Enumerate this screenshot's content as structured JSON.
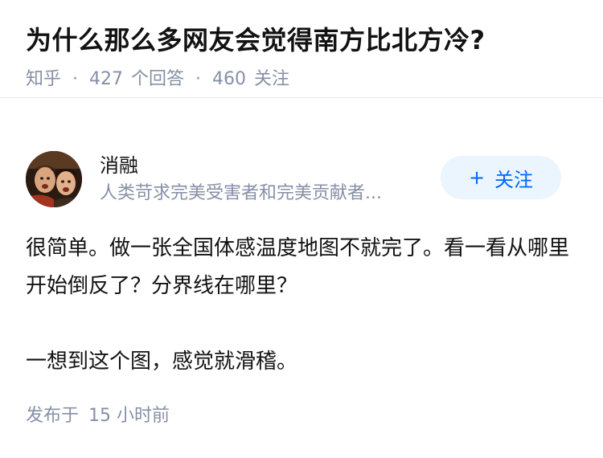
{
  "question": {
    "title": "为什么那么多网友会觉得南方比北方冷?",
    "source": "知乎",
    "answers_count": "427",
    "answers_label": "个回答",
    "followers_count": "460",
    "followers_label": "关注"
  },
  "author": {
    "name": "消融",
    "bio": "人类苛求完美受害者和完美贡献者...",
    "follow_label": "关注",
    "follow_icon": "plus-icon"
  },
  "answer": {
    "paragraphs": [
      "很简单。做一张全国体感温度地图不就完了。看一看从哪里开始倒反了？分界线在哪里？",
      "一想到这个图，感觉就滑稽。"
    ],
    "published_label": "发布于",
    "published_time": "15 小时前"
  },
  "colors": {
    "meta_gray": "#8590a6",
    "accent_blue": "#0066ff",
    "follow_bg": "#ebf5fd"
  }
}
